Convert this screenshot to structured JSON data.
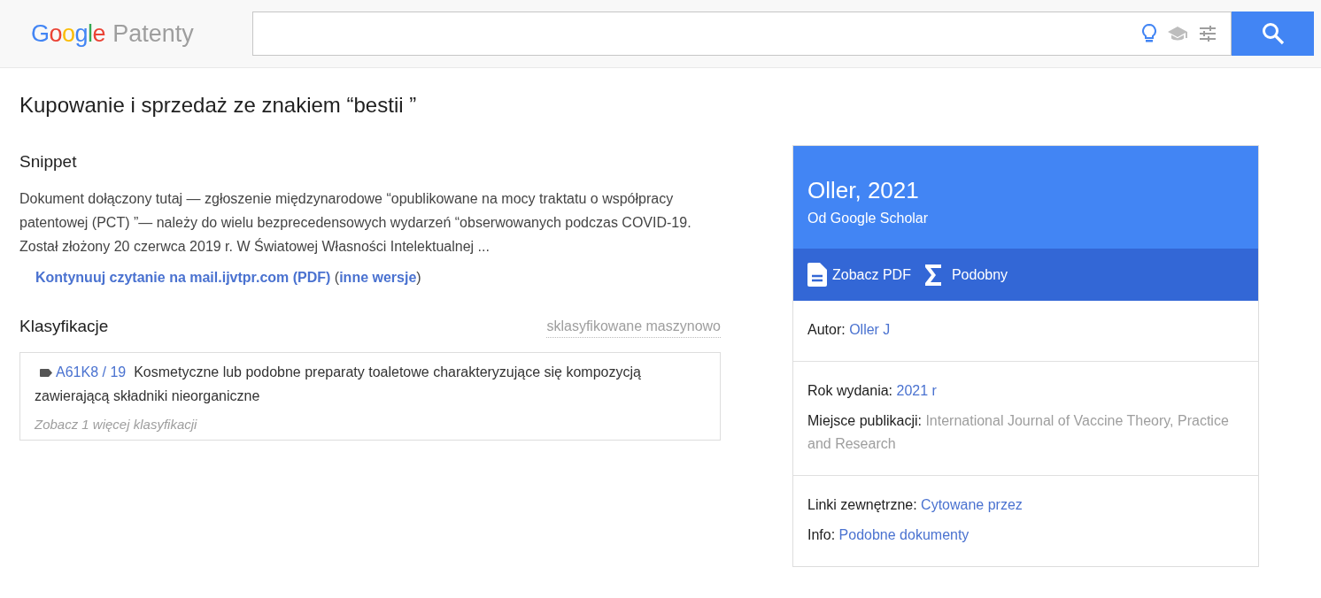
{
  "header": {
    "logo_brand": "Google",
    "logo_product": "Patenty"
  },
  "title": "Kupowanie i sprzedaż ze znakiem “bestii ”",
  "snippet": {
    "heading": "Snippet",
    "text": "Dokument dołączony tutaj — zgłoszenie międzynarodowe “opublikowane na mocy traktatu o współpracy patentowej (PCT) ”— należy do wielu bezprecedensowych wydarzeń “obserwowanych podczas COVID-19. Został złożony 20 czerwca 2019 r. W Światowej Własności Intelektualnej ...",
    "link": "Kontynuuj czytanie na mail.ijvtpr.com (PDF)",
    "open_paren": "(",
    "versions_link": "inne wersje",
    "close_paren": ")"
  },
  "classifications": {
    "heading": "Klasyfikacje",
    "note": "sklasyfikowane maszynowo",
    "items": [
      {
        "code": "A61K8 / 19",
        "description": "Kosmetyczne lub podobne preparaty toaletowe charakteryzujące się kompozycją zawierającą składniki nieorganiczne"
      }
    ],
    "more": "Zobacz 1 więcej klasyfikacji"
  },
  "card": {
    "title": "Oller, 2021",
    "subtitle": "Od Google Scholar",
    "actions": [
      {
        "kind": "pdf",
        "label": "Zobacz PDF"
      },
      {
        "kind": "similar",
        "label": "Podobny"
      }
    ],
    "sections": [
      {
        "fields": [
          {
            "label": "Autor:",
            "value": "Oller J",
            "kind": "link"
          }
        ]
      },
      {
        "fields": [
          {
            "label": "Rok wydania:",
            "value": "2021 r",
            "kind": "link"
          },
          {
            "label": "Miejsce publikacji:",
            "value": "International Journal of Vaccine Theory, Practice and Research",
            "kind": "muted"
          }
        ]
      },
      {
        "fields": [
          {
            "label": "Linki zewnętrzne:",
            "value": "Cytowane przez",
            "kind": "link"
          },
          {
            "label": "Info:",
            "value": "Podobne dokumenty",
            "kind": "link"
          }
        ]
      }
    ]
  }
}
